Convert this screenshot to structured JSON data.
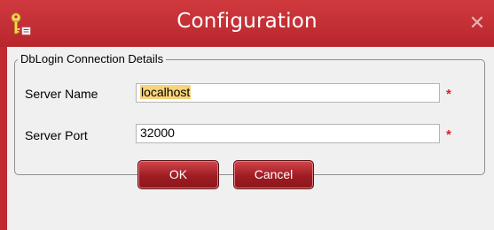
{
  "window": {
    "title": "Configuration",
    "close_symbol": "✕",
    "icon": "key-icon"
  },
  "group": {
    "legend": "DbLogin Connection Details"
  },
  "fields": {
    "server_name": {
      "label": "Server Name",
      "value": "localhost",
      "required_mark": "*"
    },
    "server_port": {
      "label": "Server Port",
      "value": "32000",
      "required_mark": "*"
    }
  },
  "buttons": {
    "ok": "OK",
    "cancel": "Cancel"
  },
  "colors": {
    "accent": "#c02a30",
    "required": "#d9232b",
    "selection": "#f7d37a"
  }
}
